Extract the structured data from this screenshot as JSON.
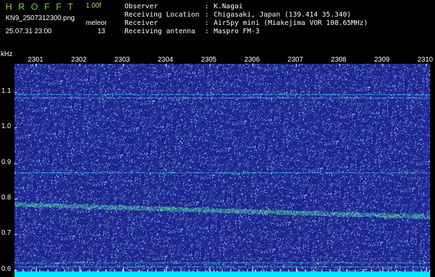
{
  "header": {
    "app_title": "HROFFT",
    "version": "1.00f",
    "filename": "KN9_2507312300.png",
    "mode": "meleor",
    "timestamp": "25.07.31 23:00",
    "count": "13"
  },
  "meta": [
    {
      "label": "Observer",
      "value": "K.Nagai"
    },
    {
      "label": "Receiving Location",
      "value": "Chigasaki, Japan (139.414 35.340)"
    },
    {
      "label": "Receiver",
      "value": "AirSpy mini (Miakejima VOR 108.65MHz)"
    },
    {
      "label": "Receiving antenna",
      "value": "Maspro FM-3"
    }
  ],
  "spectrogram": {
    "y_unit": "kHz",
    "x_ticks": [
      "2301",
      "2302",
      "2303",
      "2304",
      "2305",
      "2306",
      "2307",
      "2308",
      "2309",
      "2310"
    ],
    "y_ticks": [
      "1.1",
      "1.0",
      "0.9",
      "0.8",
      "0.7",
      "0.6"
    ],
    "y_range_khz": [
      0.58,
      1.18
    ],
    "x_range_time": [
      2300.5,
      2310.1
    ],
    "background_color": "#1a1f8a",
    "noise_color": "#7fb7ff",
    "trace_color": "#55d27a",
    "carrier_line_color": "#3fd8e0",
    "baseline_color": "#00eaff",
    "carrier_lines_khz": [
      1.095,
      1.085,
      0.875,
      0.62,
      0.61
    ],
    "signal_trace_khz": {
      "start": 0.785,
      "end": 0.75
    }
  }
}
